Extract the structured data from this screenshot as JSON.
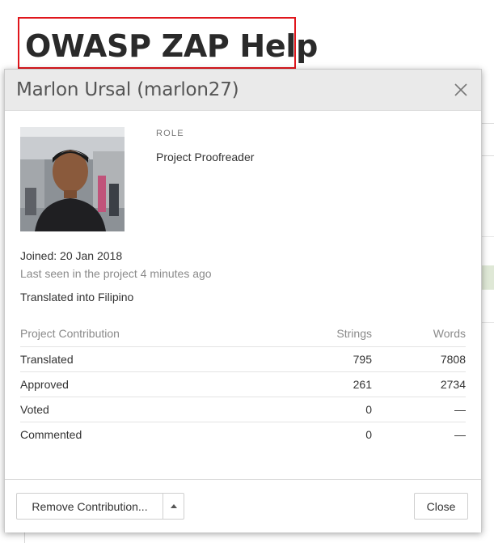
{
  "page": {
    "heading": "OWASP ZAP Help"
  },
  "dialog": {
    "title": "Marlon Ursal (marlon27)",
    "close_icon": "close-icon",
    "avatar_alt": "user-avatar-photo",
    "role_label": "ROLE",
    "role_value": "Project Proofreader",
    "joined": "Joined: 20 Jan 2018",
    "last_seen": "Last seen in the project 4 minutes ago",
    "translated_into": "Translated into Filipino",
    "contribution": {
      "header": {
        "label": "Project Contribution",
        "strings": "Strings",
        "words": "Words"
      },
      "rows": [
        {
          "label": "Translated",
          "strings": "795",
          "words": "7808"
        },
        {
          "label": "Approved",
          "strings": "261",
          "words": "2734"
        },
        {
          "label": "Voted",
          "strings": "0",
          "words": "—"
        },
        {
          "label": "Commented",
          "strings": "0",
          "words": "—"
        }
      ]
    },
    "footer": {
      "remove_label": "Remove Contribution...",
      "caret_icon": "caret-up-icon",
      "close_label": "Close"
    }
  },
  "colors": {
    "heading_box_border": "#e0161c",
    "dialog_header_bg": "#eaeaea",
    "muted_text": "#8a8a8a"
  }
}
